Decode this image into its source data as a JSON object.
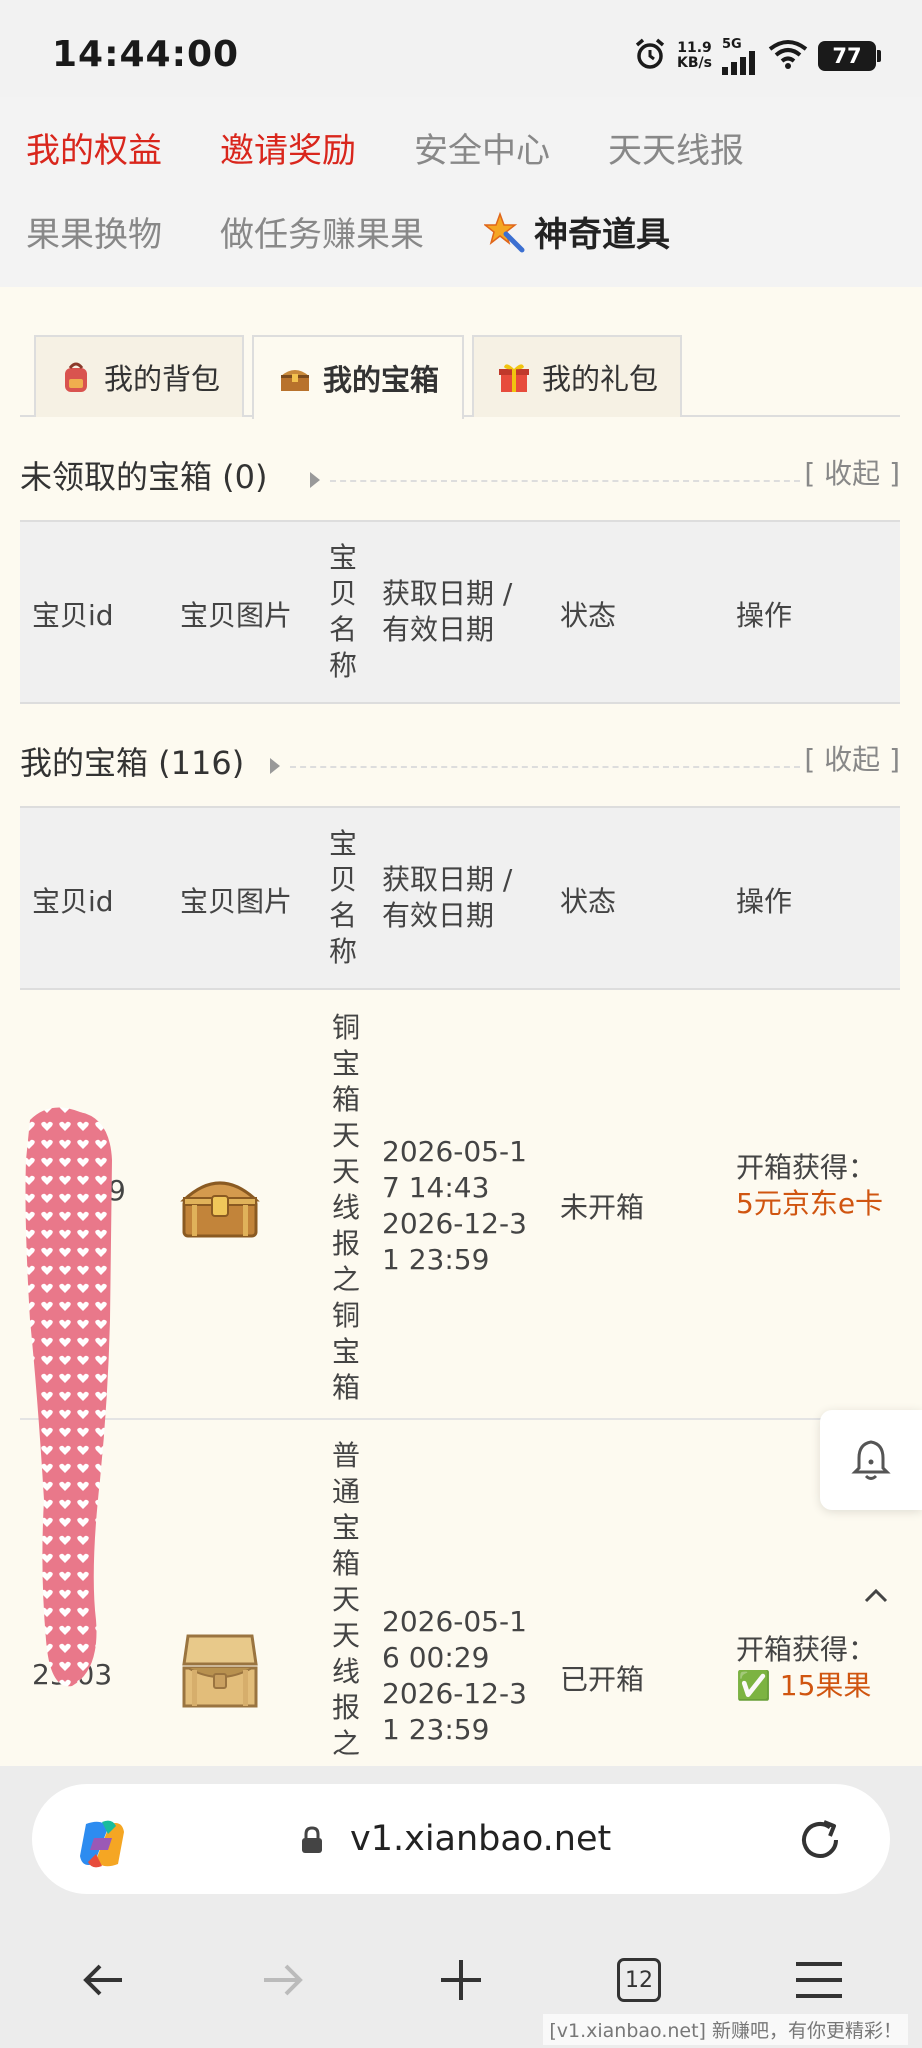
{
  "status_bar": {
    "time": "14:44:00",
    "net_speed_value": "11.9",
    "net_speed_unit": "KB/s",
    "network_type": "5G",
    "battery": "77"
  },
  "top_nav": {
    "items": [
      "我的权益",
      "邀请奖励",
      "安全中心",
      "天天线报",
      "果果换物",
      "做任务赚果果",
      "神奇道具"
    ],
    "colors": {
      "active": "#d9261c",
      "inactive": "#888888"
    }
  },
  "tabs": [
    {
      "label": "我的背包",
      "icon": "backpack-icon"
    },
    {
      "label": "我的宝箱",
      "icon": "treasure-chest-icon",
      "active": true
    },
    {
      "label": "我的礼包",
      "icon": "gift-icon"
    }
  ],
  "sections": {
    "unclaimed": {
      "title": "未领取的宝箱 (0)",
      "collapse": "[ 收起 ]"
    },
    "mine": {
      "title": "我的宝箱 (116)",
      "collapse": "[ 收起 ]"
    }
  },
  "table": {
    "headers": {
      "id": "宝贝id",
      "image": "宝贝图片",
      "name": "宝贝名称",
      "date_line1": "获取日期 /",
      "date_line2": "有效日期",
      "status": "状态",
      "action": "操作"
    },
    "rows": [
      {
        "id_partial": "9",
        "name": "铜宝箱天天线报之铜宝箱",
        "get_date": "2026-05-17 14:43",
        "valid_date": "2026-12-31 23:59",
        "status": "未开箱",
        "reward_label": "开箱获得：",
        "reward_value": "5元京东e卡"
      },
      {
        "id_partial": "23 03",
        "name": "普通宝箱天天线报之",
        "get_date": "2026-05-16 00:29",
        "valid_date": "2026-12-31 23:59",
        "status": "已开箱",
        "reward_label": "开箱获得：",
        "reward_check": "✅",
        "reward_value": "15果果"
      }
    ]
  },
  "browser": {
    "url": "v1.xianbao.net",
    "tab_count": "12"
  },
  "watermark": "[v1.xianbao.net] 新赚吧，有你更精彩！"
}
